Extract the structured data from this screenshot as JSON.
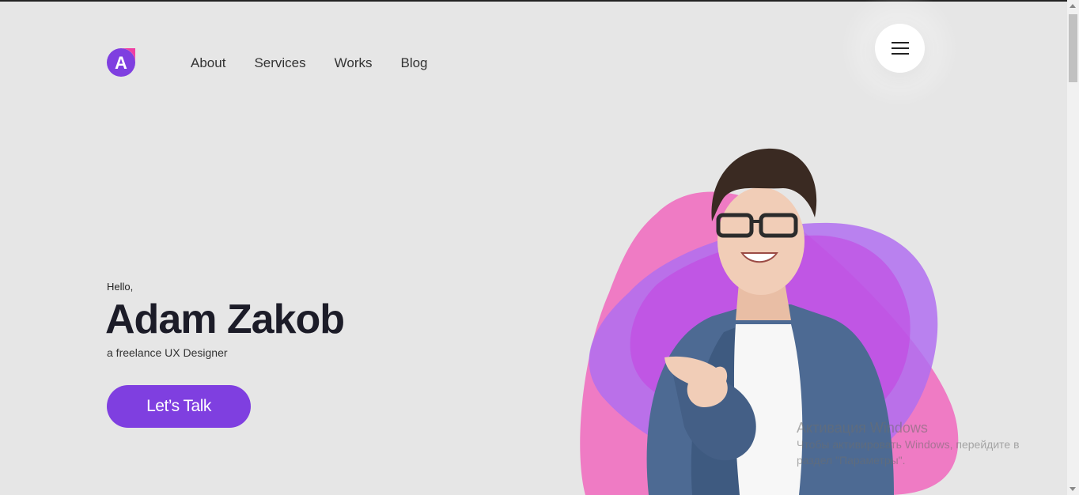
{
  "brand": {
    "logo_letter": "A",
    "colors": {
      "logo_purple": "#7f3fe0",
      "logo_pink": "#ef3fa3"
    }
  },
  "nav": {
    "items": [
      {
        "label": "About"
      },
      {
        "label": "Services"
      },
      {
        "label": "Works"
      },
      {
        "label": "Blog"
      }
    ]
  },
  "menu_button": {
    "icon": "hamburger-icon"
  },
  "hero": {
    "greeting": "Hello,",
    "name": "Adam Zakob",
    "tagline": "a freelance UX Designer",
    "cta_label": "Let’s Talk",
    "colors": {
      "accent": "#7f3fe0",
      "blob_pink": "#f06fc0",
      "blob_purple": "#b06ef0",
      "name_color": "#1c1c28"
    }
  },
  "watermark": {
    "title": "Активация Windows",
    "line1": "Чтобы активировать Windows, перейдите в",
    "line2": "раздел \"Параметры\"."
  }
}
